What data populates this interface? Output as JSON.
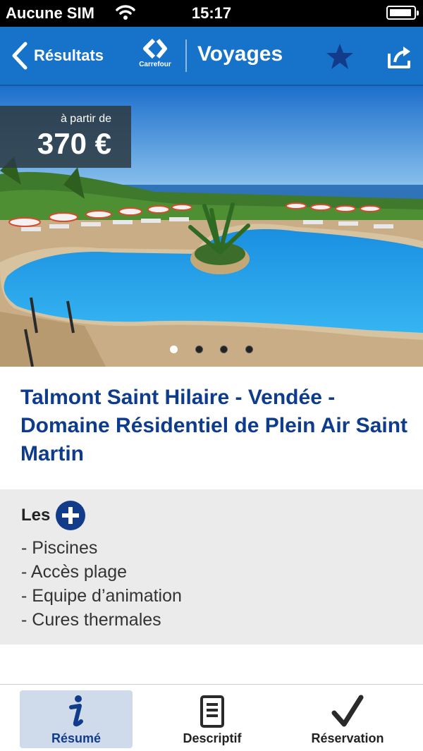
{
  "status_bar": {
    "carrier": "Aucune SIM",
    "time": "15:17"
  },
  "nav": {
    "back_label": "Résultats",
    "brand_name": "Carrefour",
    "title": "Voyages",
    "icons": [
      "chevron-left-icon",
      "carrefour-logo",
      "star-icon",
      "share-icon"
    ],
    "color": "#1673c9"
  },
  "hero": {
    "price_prefix": "à partir de",
    "price": "370 €",
    "page_count": 4,
    "current_page": 1
  },
  "listing": {
    "title": "Talmont Saint Hilaire - Vendée - Domaine Résidentiel de Plein Air Saint Martin",
    "title_color": "#0e3c8c"
  },
  "highlights": {
    "heading": "Les",
    "items": [
      "- Piscines",
      "- Accès plage",
      "- Equipe d’animation",
      "- Cures thermales"
    ]
  },
  "tabs": [
    {
      "label": "Résumé",
      "icon": "info-icon",
      "selected": true
    },
    {
      "label": "Descriptif",
      "icon": "document-icon",
      "selected": false
    },
    {
      "label": "Réservation",
      "icon": "checkmark-icon",
      "selected": false
    }
  ]
}
